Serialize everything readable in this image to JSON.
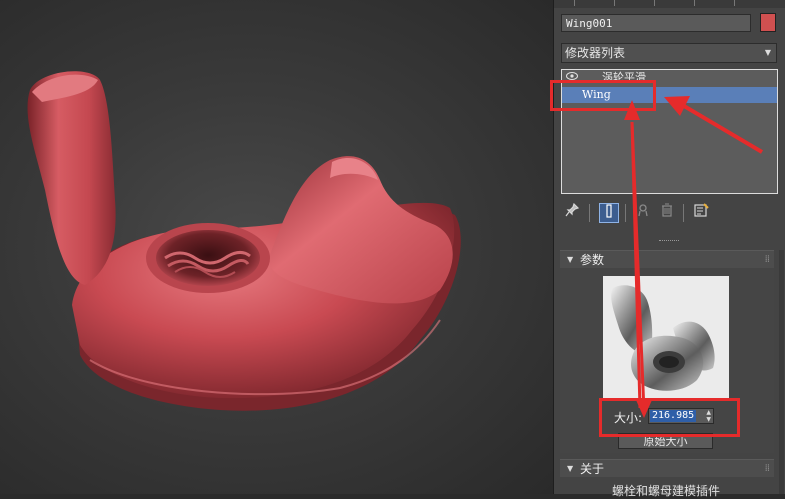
{
  "object_name": "Wing001",
  "object_color": "#d05050",
  "modifier_list": {
    "label": "修改器列表"
  },
  "modifier_stack": [
    {
      "label": "涡轮平滑",
      "selected": false
    },
    {
      "label": "Wing",
      "selected": true
    }
  ],
  "stack_tools": {
    "pin_icon": "pin-icon",
    "show_end_icon": "show-end-result-icon",
    "make_unique_icon": "make-unique-icon",
    "remove_icon": "trash-icon",
    "configure_icon": "configure-modifier-sets-icon"
  },
  "params_rollout": {
    "title": "参数",
    "size_label": "大小:",
    "size_value": "216.985",
    "original_size_button": "原始大小"
  },
  "about_rollout": {
    "title": "关于",
    "text": "螺栓和螺母建模插件"
  },
  "annotation_color": "#e52b2b",
  "model_color": "#c94a52"
}
